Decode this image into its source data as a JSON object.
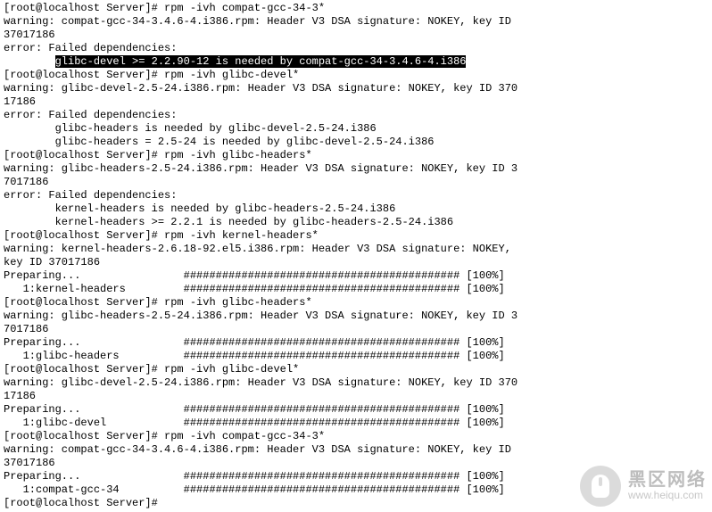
{
  "prompt": "[root@localhost Server]#",
  "cmd1": "rpm -ivh compat-gcc-34-3*",
  "warn1a": "warning: compat-gcc-34-3.4.6-4.i386.rpm: Header V3 DSA signature: NOKEY, key ID ",
  "warn1b": "37017186",
  "err": "error: Failed dependencies:",
  "dep1_pre": "        ",
  "dep1_hl": "glibc-devel >= 2.2.90-12 is needed by compat-gcc-34-3.4.6-4.i386",
  "cmd2": "rpm -ivh glibc-devel*",
  "warn2a": "warning: glibc-devel-2.5-24.i386.rpm: Header V3 DSA signature: NOKEY, key ID 370",
  "warn2b": "17186",
  "dep2a": "        glibc-headers is needed by glibc-devel-2.5-24.i386",
  "dep2b": "        glibc-headers = 2.5-24 is needed by glibc-devel-2.5-24.i386",
  "cmd3": "rpm -ivh glibc-headers*",
  "warn3a": "warning: glibc-headers-2.5-24.i386.rpm: Header V3 DSA signature: NOKEY, key ID 3",
  "warn3b": "7017186",
  "dep3a": "        kernel-headers is needed by glibc-headers-2.5-24.i386",
  "dep3b": "        kernel-headers >= 2.2.1 is needed by glibc-headers-2.5-24.i386",
  "cmd4": "rpm -ivh kernel-headers*",
  "warn4a": "warning: kernel-headers-2.6.18-92.el5.i386.rpm: Header V3 DSA signature: NOKEY, ",
  "warn4b": "key ID 37017186",
  "prep": "Preparing...                ########################################### [100%]",
  "pkg_kh": "   1:kernel-headers         ########################################### [100%]",
  "cmd5": "rpm -ivh glibc-headers*",
  "warn5a": "warning: glibc-headers-2.5-24.i386.rpm: Header V3 DSA signature: NOKEY, key ID 3",
  "warn5b": "7017186",
  "pkg_gh": "   1:glibc-headers          ########################################### [100%]",
  "cmd6": "rpm -ivh glibc-devel*",
  "warn6a": "warning: glibc-devel-2.5-24.i386.rpm: Header V3 DSA signature: NOKEY, key ID 370",
  "warn6b": "17186",
  "pkg_gd": "   1:glibc-devel            ########################################### [100%]",
  "cmd7": "rpm -ivh compat-gcc-34-3*",
  "warn7a": "warning: compat-gcc-34-3.4.6-4.i386.rpm: Header V3 DSA signature: NOKEY, key ID ",
  "warn7b": "37017186",
  "pkg_cg": "   1:compat-gcc-34          ########################################### [100%]",
  "empty_cmd": "",
  "watermark": {
    "cn": "黑区网络",
    "url": "www.heiqu.com"
  }
}
